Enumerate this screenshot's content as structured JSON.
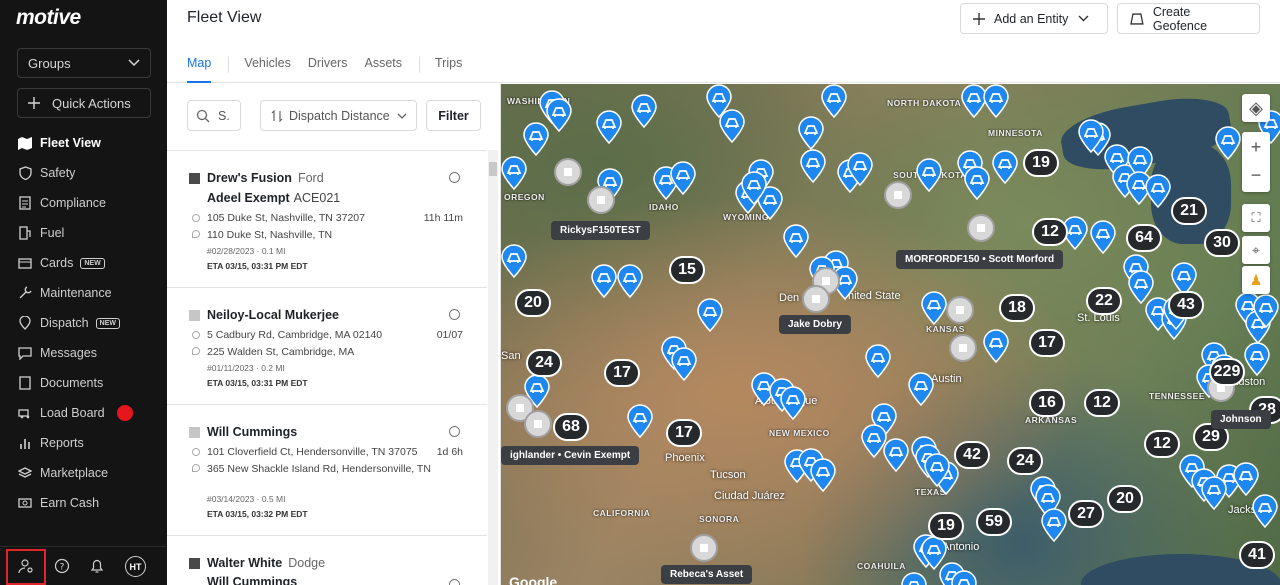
{
  "app": {
    "logo": "motive"
  },
  "sidebar": {
    "groups_label": "Groups",
    "quick_actions_label": "Quick Actions",
    "items": [
      {
        "label": "Fleet View",
        "icon": "map-icon",
        "active": true
      },
      {
        "label": "Safety",
        "icon": "shield-icon"
      },
      {
        "label": "Compliance",
        "icon": "document-icon"
      },
      {
        "label": "Fuel",
        "icon": "fuel-icon"
      },
      {
        "label": "Cards",
        "icon": "card-icon",
        "badge": "NEW"
      },
      {
        "label": "Maintenance",
        "icon": "wrench-icon"
      },
      {
        "label": "Dispatch",
        "icon": "dispatch-icon",
        "badge": "NEW"
      },
      {
        "label": "Messages",
        "icon": "messages-icon"
      },
      {
        "label": "Documents",
        "icon": "documents-icon"
      },
      {
        "label": "Load Board",
        "icon": "load-board-icon"
      },
      {
        "label": "Reports",
        "icon": "reports-icon"
      },
      {
        "label": "Marketplace",
        "icon": "marketplace-icon"
      },
      {
        "label": "Earn Cash",
        "icon": "cash-icon"
      }
    ],
    "avatar_initials": "HT"
  },
  "header": {
    "title": "Fleet View",
    "add_entity_label": "Add an Entity",
    "create_geofence_label": "Create Geofence",
    "tabs": [
      "Map",
      "Vehicles",
      "Drivers",
      "Assets",
      "Trips"
    ]
  },
  "list": {
    "search_placeholder": "S.",
    "sort_label": "Dispatch Distance",
    "filter_label": "Filter",
    "cards": [
      {
        "vehicle": "Drew's Fusion",
        "make": "Ford",
        "driver": "Adeel Exempt",
        "driver_id": "ACE021",
        "from": "105 Duke St, Nashville, TN 37207",
        "to": "110 Duke St, Nashville, TN",
        "time": "11h 11m",
        "meta": "#02/28/2023  ·  0.1 MI",
        "eta": "ETA 03/15, 03:31 PM EDT"
      },
      {
        "vehicle": "Neiloy-Local Mukerjee",
        "make": "",
        "driver": "",
        "driver_id": "",
        "from": "5 Cadbury Rd, Cambridge, MA 02140",
        "to": "225 Walden St, Cambridge, MA",
        "time": "01/07",
        "meta": "#01/11/2023  ·  0.2 MI",
        "eta": "ETA 03/15, 03:31 PM EDT"
      },
      {
        "vehicle": "Will Cummings",
        "make": "",
        "driver": "",
        "driver_id": "",
        "from": "101 Cloverfield Ct, Hendersonville, TN 37075",
        "to": "365 New Shackle Island Rd, Hendersonville, TN",
        "time": "1d 6h",
        "meta": "#03/14/2023  ·  0.5 MI",
        "eta": "ETA 03/15, 03:32 PM EDT"
      },
      {
        "vehicle": "Walter White",
        "make": "Dodge",
        "driver": "Will Cummings",
        "driver_id": "",
        "from": "",
        "to": "",
        "time": "",
        "meta": "",
        "eta": ""
      }
    ]
  },
  "map": {
    "labels": [
      "WASHINGTON",
      "NORTH DAKOTA",
      "MINNESOTA",
      "SOUTH DAKOTA",
      "OREGON",
      "IDAHO",
      "WYOMING",
      "KANSAS",
      "NEW MEXICO",
      "ARKANSAS",
      "TENNESSEE",
      "TEXAS",
      "CALIFORNIA",
      "SONORA",
      "COAHUILA"
    ],
    "cities": [
      "Den",
      "nited State",
      "St. Louis",
      "Albuquerque",
      "Phoenix",
      "Tucson",
      "Ciudad Juárez",
      "Austin",
      "Antonio",
      "Jacks",
      "Auston",
      "San"
    ],
    "clusters": [
      "19",
      "21",
      "30",
      "12",
      "64",
      "15",
      "20",
      "22",
      "43",
      "18",
      "17",
      "229",
      "24",
      "17",
      "16",
      "12",
      "28",
      "68",
      "17",
      "12",
      "29",
      "42",
      "24",
      "20",
      "19",
      "59",
      "27",
      "41"
    ],
    "tags": [
      "RickysF150TEST",
      "MORFORDF150 • Scott Morford",
      "Jake Dobry",
      "ighlander • Cevin Exempt",
      "Rebeca's Asset",
      "Johnson"
    ],
    "attribution": "Google"
  }
}
